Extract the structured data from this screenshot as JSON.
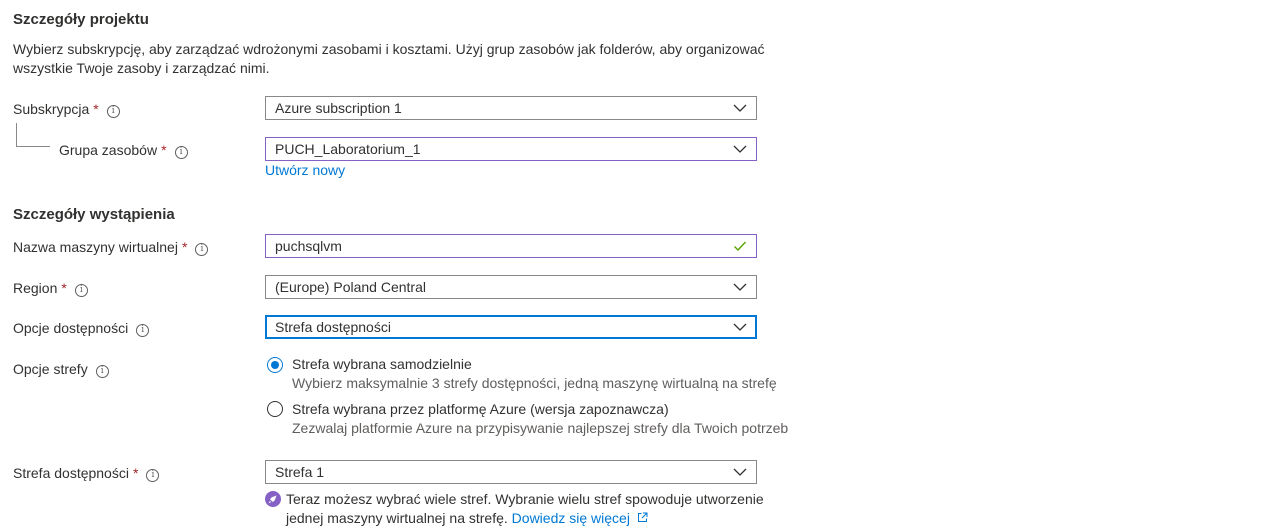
{
  "project": {
    "heading": "Szczegóły projektu",
    "description_line1": "Wybierz subskrypcję, aby zarządzać wdrożonymi zasobami i kosztami. Użyj grup zasobów jak folderów, aby organizować",
    "description_line2": "wszystkie Twoje zasoby i zarządzać nimi.",
    "subscription_label": "Subskrypcja",
    "subscription_value": "Azure subscription 1",
    "resource_group_label": "Grupa zasobów",
    "resource_group_value": "PUCH_Laboratorium_1",
    "create_new_link": "Utwórz nowy"
  },
  "instance": {
    "heading": "Szczegóły wystąpienia",
    "vm_name_label": "Nazwa maszyny wirtualnej",
    "vm_name_value": "puchsqlvm",
    "region_label": "Region",
    "region_value": "(Europe) Poland Central",
    "availability_options_label": "Opcje dostępności",
    "availability_options_value": "Strefa dostępności",
    "zone_options_label": "Opcje strefy",
    "zone_options": [
      {
        "title": "Strefa wybrana samodzielnie",
        "description": "Wybierz maksymalnie 3 strefy dostępności, jedną maszynę wirtualną na strefę",
        "selected": true
      },
      {
        "title": "Strefa wybrana przez platformę Azure (wersja zapoznawcza)",
        "description": "Zezwalaj platformie Azure na przypisywanie najlepszej strefy dla Twoich potrzeb",
        "selected": false
      }
    ],
    "availability_zone_label": "Strefa dostępności",
    "availability_zone_value": "Strefa 1",
    "info_line1": "Teraz możesz wybrać wiele stref. Wybranie wielu stref spowoduje utworzenie",
    "info_line2": "jednej maszyny wirtualnej na strefę.",
    "learn_more_link": "Dowiedz się więcej"
  },
  "required_marker": "*",
  "info_glyph": "i",
  "colors": {
    "accent": "#0078d4",
    "required": "#a4262c",
    "purple_border": "#8661c5",
    "valid_check": "#57a300",
    "info_badge": "#8661c5"
  },
  "icons": [
    "chevron-down-icon",
    "info-icon",
    "checkmark-icon",
    "rocket-icon",
    "external-link-icon",
    "radio-button"
  ]
}
